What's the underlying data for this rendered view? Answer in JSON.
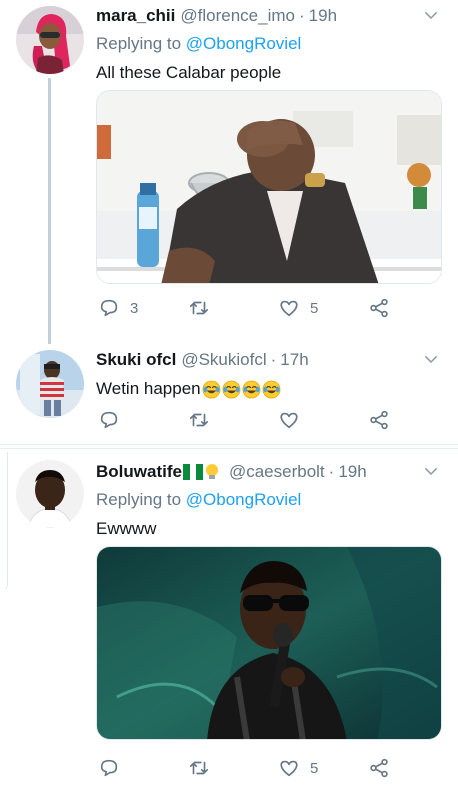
{
  "tweets": [
    {
      "name": "mara_chii",
      "handle": "@florence_imo",
      "dot": "·",
      "time": "19h",
      "replying_prefix": "Replying to ",
      "replying_to": "@ObongRoviel",
      "text": "All these Calabar people",
      "media_icon": "photo-man-facepalm-at-podium",
      "replies": "3",
      "likes": "5"
    },
    {
      "name": "Skuki ofcl",
      "handle": "@Skukiofcl",
      "dot": "·",
      "time": "17h",
      "text": "Wetin happen",
      "emoji_icon": "face-with-tears-of-joy-icon"
    },
    {
      "name": "Boluwatife",
      "name_badges": [
        "nigeria-flag-icon",
        "lightbulb-icon"
      ],
      "handle": "@caeserbolt",
      "dot": "·",
      "time": "19h",
      "replying_prefix": "Replying to ",
      "replying_to": "@ObongRoviel",
      "text": "Ewwww",
      "media_icon": "photo-singer-with-sunglasses-and-microphone",
      "likes": "5"
    }
  ],
  "colors": {
    "accent": "#1da1f2",
    "secondary_text": "#657786",
    "divider": "#e6ecf0"
  }
}
